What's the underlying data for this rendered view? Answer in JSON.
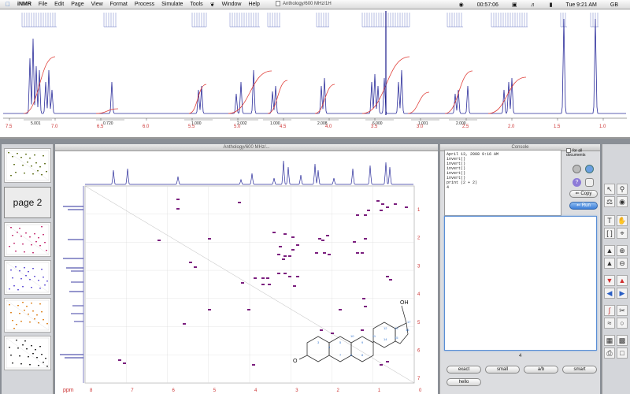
{
  "menubar": {
    "app": "iNMR",
    "items": [
      "File",
      "Edit",
      "Page",
      "View",
      "Format",
      "Process",
      "Simulate",
      "Tools",
      "Window",
      "Help"
    ],
    "clock": "00:57:06",
    "date_time": "Tue 9:21 AM",
    "lang": "GB"
  },
  "window": {
    "title": "Anthology/600 MHz/1H",
    "title2": "Anthology/600 MHz/..."
  },
  "spectrum": {
    "integrals": [
      "5.001",
      "0.720",
      "1.000",
      "2.002",
      "1.000",
      "2.008",
      "6.000",
      "1.001",
      "2.000"
    ],
    "ticks": [
      "7.5",
      "7.0",
      "6.5",
      "6.0",
      "5.5",
      "5.0",
      "4.5",
      "4.0",
      "3.5",
      "3.0",
      "2.5",
      "2.0",
      "1.5",
      "1.0"
    ]
  },
  "pages": {
    "page2_label": "page 2"
  },
  "plot2d": {
    "xlabel": "ppm",
    "xticks": [
      "8",
      "7",
      "6",
      "5",
      "4",
      "3",
      "2",
      "1",
      "0"
    ],
    "yticks": [
      "1",
      "2",
      "3",
      "4",
      "5",
      "6",
      "7"
    ]
  },
  "molecule": {
    "oh": "OH",
    "o": "O"
  },
  "console": {
    "title": "Console",
    "output": "April 13, 2008 9:16 AM\ninvert()\ninvert()\ninvert()\ninvert()\ninvert()\nprint (2 + 2)\n4",
    "all_documents": "for all documents",
    "copy": "Copy",
    "run": "Run",
    "result": "4",
    "buttons": [
      "exact",
      "small",
      "a/b",
      "smart",
      "hello"
    ]
  },
  "colors": {
    "spectrum": "#2b2d9b",
    "integral": "#e0403a",
    "cross": "#7b1f7e",
    "accent": "#5a8fd6"
  }
}
